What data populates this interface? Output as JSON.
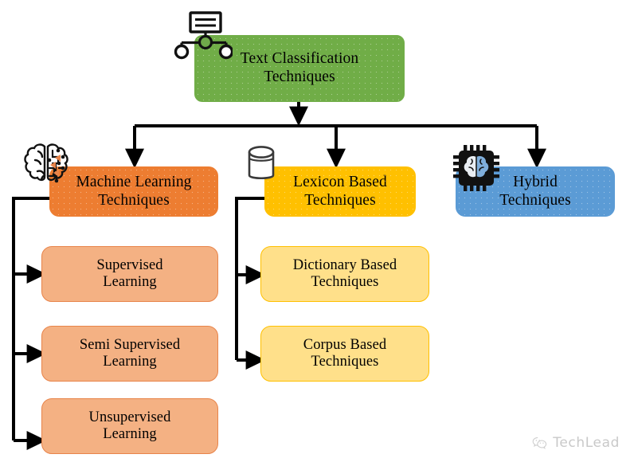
{
  "diagram": {
    "title_node": {
      "line1": "Text Classification",
      "line2": "Techniques"
    },
    "level2": [
      {
        "id": "machine-learning",
        "line1": "Machine Learning",
        "line2": "Techniques",
        "color": "#ED7D31",
        "icon": "brain-icon"
      },
      {
        "id": "lexicon-based",
        "line1": "Lexicon Based",
        "line2": "Techniques",
        "color": "#FFC000",
        "icon": "database-icon"
      },
      {
        "id": "hybrid",
        "line1": "Hybrid",
        "line2": "Techniques",
        "color": "#5B9BD5",
        "icon": "ai-chip-icon"
      }
    ],
    "ml_children": [
      {
        "id": "supervised-learning",
        "line1": "Supervised",
        "line2": "Learning"
      },
      {
        "id": "semi-supervised-learning",
        "line1": "Semi Supervised",
        "line2": "Learning"
      },
      {
        "id": "unsupervised-learning",
        "line1": "Unsupervised",
        "line2": "Learning"
      }
    ],
    "lexicon_children": [
      {
        "id": "dictionary-based",
        "line1": "Dictionary Based",
        "line2": "Techniques"
      },
      {
        "id": "corpus-based",
        "line1": "Corpus Based",
        "line2": "Techniques"
      }
    ],
    "icons": {
      "root": "hierarchy-icon",
      "ml": "brain-icon",
      "lexicon": "database-icon",
      "hybrid": "ai-chip-icon"
    },
    "colors": {
      "root_fill": "#70AD47",
      "ml_fill": "#ED7D31",
      "lexicon_fill": "#FFC000",
      "hybrid_fill": "#5B9BD5",
      "ml_child_fill": "#F4B183",
      "ml_child_border": "#E8844A",
      "lexicon_child_fill": "#FFE08A",
      "lexicon_child_border": "#FFC000",
      "connector": "#000000",
      "background": "#FFFFFF"
    }
  },
  "watermark": {
    "text": "TechLead",
    "icon": "wechat-icon"
  }
}
